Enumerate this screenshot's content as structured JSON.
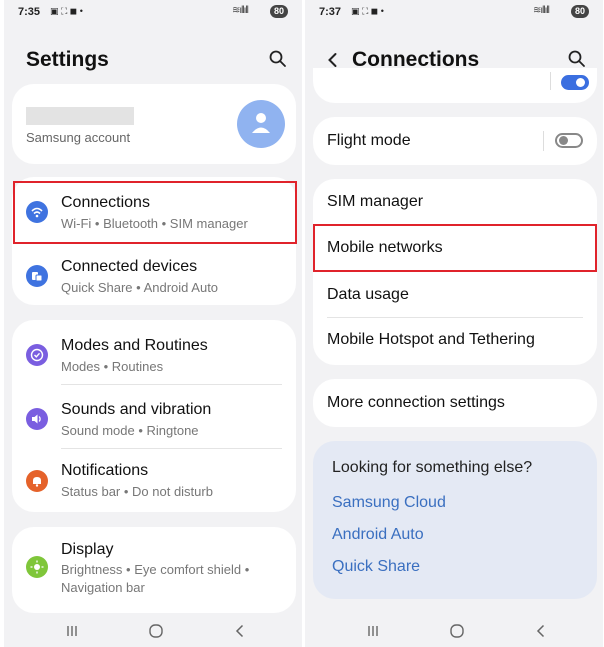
{
  "left_screen": {
    "status": {
      "time": "7:35",
      "battery": "80"
    },
    "title": "Settings",
    "account": {
      "label": "Samsung account"
    },
    "items": [
      {
        "title": "Connections",
        "subtitle": "Wi-Fi  •  Bluetooth  •  SIM manager",
        "icon": "wifi-icon",
        "color": "#3f73e0"
      },
      {
        "title": "Connected devices",
        "subtitle": "Quick Share  •  Android Auto",
        "icon": "devices-icon",
        "color": "#3f73e0"
      },
      {
        "title": "Modes and Routines",
        "subtitle": "Modes  •  Routines",
        "icon": "check-circle-icon",
        "color": "#7a5ee0"
      },
      {
        "title": "Sounds and vibration",
        "subtitle": "Sound mode  •  Ringtone",
        "icon": "volume-icon",
        "color": "#7a5ee0"
      },
      {
        "title": "Notifications",
        "subtitle": "Status bar  •  Do not disturb",
        "icon": "bell-icon",
        "color": "#e5622a"
      },
      {
        "title": "Display",
        "subtitle_1": "Brightness  •  Eye comfort shield  •",
        "subtitle_2": "Navigation bar",
        "icon": "sun-icon",
        "color": "#7fc63a"
      }
    ]
  },
  "right_screen": {
    "status": {
      "time": "7:37",
      "battery": "80"
    },
    "title": "Connections",
    "items": {
      "flight_mode": "Flight mode",
      "sim_manager": "SIM manager",
      "mobile_networks": "Mobile networks",
      "data_usage": "Data usage",
      "hotspot": "Mobile Hotspot and Tethering",
      "more": "More connection settings"
    },
    "suggestions": {
      "heading": "Looking for something else?",
      "links": [
        "Samsung Cloud",
        "Android Auto",
        "Quick Share"
      ]
    }
  },
  "colors": {
    "accent": "#3f73e0",
    "highlight": "#e0232b",
    "link": "#3a6fc0"
  }
}
